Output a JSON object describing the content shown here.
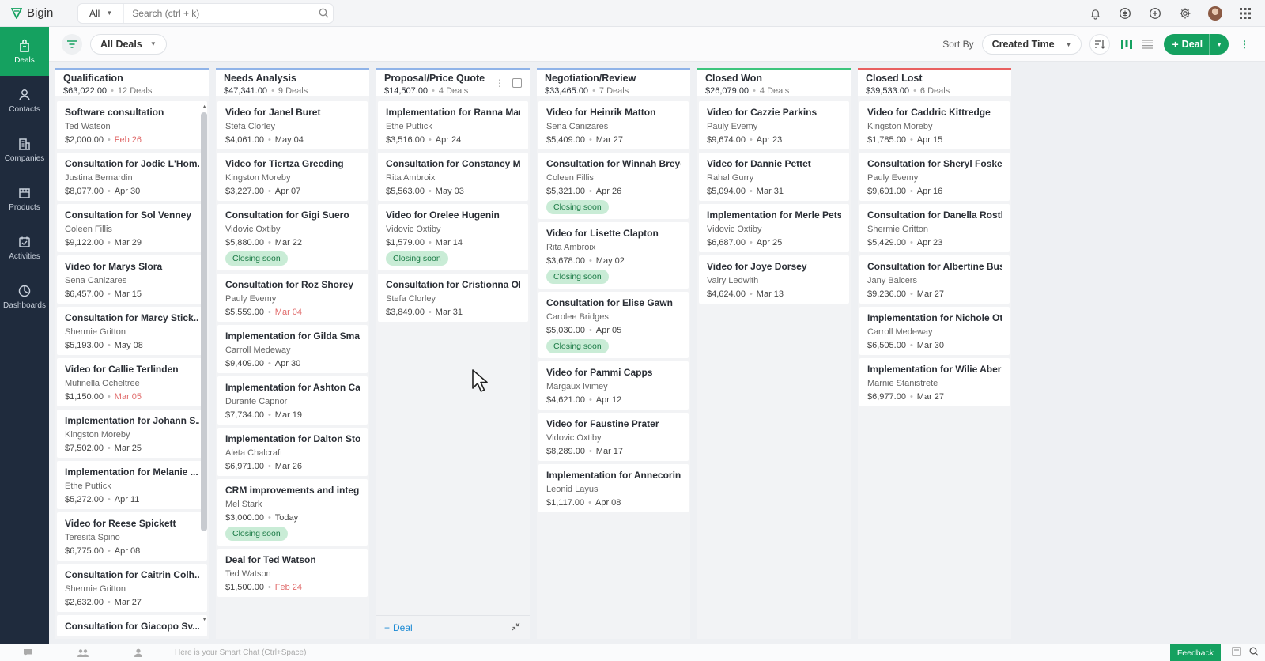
{
  "app": {
    "name": "Bigin"
  },
  "search": {
    "scope": "All",
    "placeholder": "Search (ctrl + k)"
  },
  "sidebar": {
    "items": [
      {
        "label": "Deals",
        "icon": "deals-icon",
        "active": true
      },
      {
        "label": "Contacts",
        "icon": "contacts-icon"
      },
      {
        "label": "Companies",
        "icon": "companies-icon"
      },
      {
        "label": "Products",
        "icon": "products-icon"
      },
      {
        "label": "Activities",
        "icon": "activities-icon"
      },
      {
        "label": "Dashboards",
        "icon": "dashboards-icon"
      }
    ]
  },
  "toolbar": {
    "view": "All Deals",
    "sort_label": "Sort By",
    "sort_value": "Created Time",
    "add_label": "Deal"
  },
  "colors": {
    "brand": "#15a160",
    "sidebar": "#1f2b3d",
    "won": "#3cc47c",
    "lost": "#e86060",
    "open": "#8fb3e8"
  },
  "columns": [
    {
      "title": "Qualification",
      "amount": "$63,022.00",
      "count": "12 Deals",
      "status": "open",
      "cards": [
        {
          "title": "Software consultation",
          "contact": "Ted Watson",
          "amount": "$2,000.00",
          "date": "Feb 26",
          "late": true
        },
        {
          "title": "Consultation for Jodie L'Hom...",
          "contact": "Justina Bernardin",
          "amount": "$8,077.00",
          "date": "Apr 30"
        },
        {
          "title": "Consultation for Sol Venney",
          "contact": "Coleen Fillis",
          "amount": "$9,122.00",
          "date": "Mar 29"
        },
        {
          "title": "Video for Marys Slora",
          "contact": "Sena Canizares",
          "amount": "$6,457.00",
          "date": "Mar 15"
        },
        {
          "title": "Consultation for Marcy Stick...",
          "contact": "Shermie Gritton",
          "amount": "$5,193.00",
          "date": "May 08"
        },
        {
          "title": "Video for Callie Terlinden",
          "contact": "Mufinella Ocheltree",
          "amount": "$1,150.00",
          "date": "Mar 05",
          "late": true
        },
        {
          "title": "Implementation for Johann S...",
          "contact": "Kingston Moreby",
          "amount": "$7,502.00",
          "date": "Mar 25"
        },
        {
          "title": "Implementation for Melanie ...",
          "contact": "Ethe Puttick",
          "amount": "$5,272.00",
          "date": "Apr 11"
        },
        {
          "title": "Video for Reese Spickett",
          "contact": "Teresita Spino",
          "amount": "$6,775.00",
          "date": "Apr 08"
        },
        {
          "title": "Consultation for Caitrin Colh...",
          "contact": "Shermie Gritton",
          "amount": "$2,632.00",
          "date": "Mar 27"
        },
        {
          "title": "Consultation for Giacopo Sv...",
          "contact": "",
          "amount": "",
          "date": ""
        }
      ]
    },
    {
      "title": "Needs Analysis",
      "amount": "$47,341.00",
      "count": "9 Deals",
      "status": "open",
      "cards": [
        {
          "title": "Video for Janel Buret",
          "contact": "Stefa Clorley",
          "amount": "$4,061.00",
          "date": "May 04"
        },
        {
          "title": "Video for Tiertza Greeding",
          "contact": "Kingston Moreby",
          "amount": "$3,227.00",
          "date": "Apr 07"
        },
        {
          "title": "Consultation for Gigi Suero",
          "contact": "Vidovic Oxtiby",
          "amount": "$5,880.00",
          "date": "Mar 22",
          "badge": "Closing soon"
        },
        {
          "title": "Consultation for Roz Shorey",
          "contact": "Pauly Evemy",
          "amount": "$5,559.00",
          "date": "Mar 04",
          "late": true
        },
        {
          "title": "Implementation for Gilda Smale",
          "contact": "Carroll Medeway",
          "amount": "$9,409.00",
          "date": "Apr 30"
        },
        {
          "title": "Implementation for Ashton Cad...",
          "contact": "Durante Capnor",
          "amount": "$7,734.00",
          "date": "Mar 19"
        },
        {
          "title": "Implementation for Dalton Ston...",
          "contact": "Aleta Chalcraft",
          "amount": "$6,971.00",
          "date": "Mar 26"
        },
        {
          "title": "CRM improvements and integra...",
          "contact": "Mel Stark",
          "amount": "$3,000.00",
          "date": "Today",
          "badge": "Closing soon"
        },
        {
          "title": "Deal for Ted Watson",
          "contact": "Ted Watson",
          "amount": "$1,500.00",
          "date": "Feb 24",
          "late": true
        }
      ]
    },
    {
      "title": "Proposal/Price Quote",
      "amount": "$14,507.00",
      "count": "4 Deals",
      "status": "open",
      "add_label": "Deal",
      "cards": [
        {
          "title": "Implementation for Ranna Marr...",
          "contact": "Ethe Puttick",
          "amount": "$3,516.00",
          "date": "Apr 24"
        },
        {
          "title": "Consultation for Constancy Mc...",
          "contact": "Rita Ambroix",
          "amount": "$5,563.00",
          "date": "May 03"
        },
        {
          "title": "Video for Orelee Hugenin",
          "contact": "Vidovic Oxtiby",
          "amount": "$1,579.00",
          "date": "Mar 14",
          "badge": "Closing soon"
        },
        {
          "title": "Consultation for Cristionna Old...",
          "contact": "Stefa Clorley",
          "amount": "$3,849.00",
          "date": "Mar 31"
        }
      ]
    },
    {
      "title": "Negotiation/Review",
      "amount": "$33,465.00",
      "count": "7 Deals",
      "status": "open",
      "cards": [
        {
          "title": "Video for Heinrik Matton",
          "contact": "Sena Canizares",
          "amount": "$5,409.00",
          "date": "Mar 27"
        },
        {
          "title": "Consultation for Winnah Breydin",
          "contact": "Coleen Fillis",
          "amount": "$5,321.00",
          "date": "Apr 26",
          "badge": "Closing soon"
        },
        {
          "title": "Video for Lisette Clapton",
          "contact": "Rita Ambroix",
          "amount": "$3,678.00",
          "date": "May 02",
          "badge": "Closing soon"
        },
        {
          "title": "Consultation for Elise Gawn",
          "contact": "Carolee Bridges",
          "amount": "$5,030.00",
          "date": "Apr 05",
          "badge": "Closing soon"
        },
        {
          "title": "Video for Pammi Capps",
          "contact": "Margaux Ivimey",
          "amount": "$4,621.00",
          "date": "Apr 12"
        },
        {
          "title": "Video for Faustine Prater",
          "contact": "Vidovic Oxtiby",
          "amount": "$8,289.00",
          "date": "Mar 17"
        },
        {
          "title": "Implementation for Annecorinn...",
          "contact": "Leonid Layus",
          "amount": "$1,117.00",
          "date": "Apr 08"
        }
      ]
    },
    {
      "title": "Closed Won",
      "amount": "$26,079.00",
      "count": "4 Deals",
      "status": "won",
      "cards": [
        {
          "title": "Video for Cazzie Parkins",
          "contact": "Pauly Evemy",
          "amount": "$9,674.00",
          "date": "Apr 23"
        },
        {
          "title": "Video for Dannie Pettet",
          "contact": "Rahal Gurry",
          "amount": "$5,094.00",
          "date": "Mar 31"
        },
        {
          "title": "Implementation for Merle Petsc...",
          "contact": "Vidovic Oxtiby",
          "amount": "$6,687.00",
          "date": "Apr 25"
        },
        {
          "title": "Video for Joye Dorsey",
          "contact": "Valry Ledwith",
          "amount": "$4,624.00",
          "date": "Mar 13"
        }
      ]
    },
    {
      "title": "Closed Lost",
      "amount": "$39,533.00",
      "count": "6 Deals",
      "status": "lost",
      "cards": [
        {
          "title": "Video for Caddric Kittredge",
          "contact": "Kingston Moreby",
          "amount": "$1,785.00",
          "date": "Apr 15"
        },
        {
          "title": "Consultation for Sheryl Foskew",
          "contact": "Pauly Evemy",
          "amount": "$9,601.00",
          "date": "Apr 16"
        },
        {
          "title": "Consultation for Danella Rosth...",
          "contact": "Shermie Gritton",
          "amount": "$5,429.00",
          "date": "Apr 23"
        },
        {
          "title": "Consultation for Albertine Busch",
          "contact": "Jany Balcers",
          "amount": "$9,236.00",
          "date": "Mar 27"
        },
        {
          "title": "Implementation for Nichole Ott...",
          "contact": "Carroll Medeway",
          "amount": "$6,505.00",
          "date": "Mar 30"
        },
        {
          "title": "Implementation for Wilie Aberc...",
          "contact": "Marnie Stanistrete",
          "amount": "$6,977.00",
          "date": "Mar 27"
        }
      ]
    }
  ],
  "bottom": {
    "smart_chat_placeholder": "Here is your Smart Chat (Ctrl+Space)",
    "feedback_label": "Feedback"
  }
}
